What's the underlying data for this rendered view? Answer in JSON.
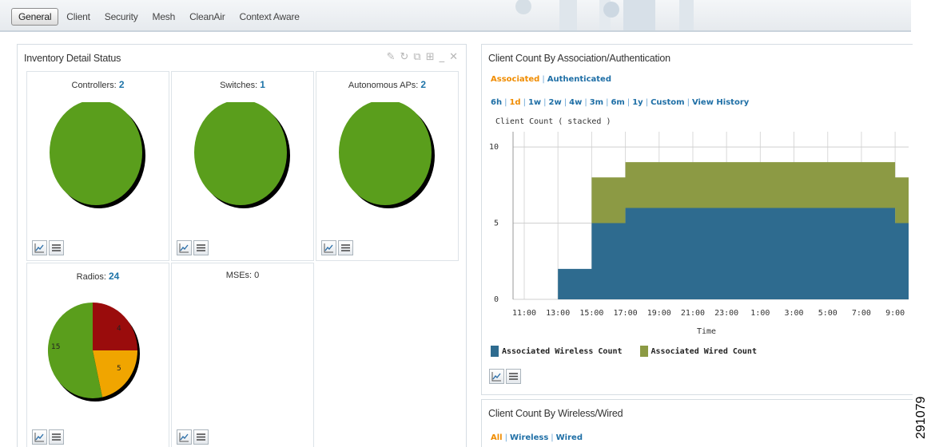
{
  "tabs": [
    {
      "label": "General",
      "active": true
    },
    {
      "label": "Client",
      "active": false
    },
    {
      "label": "Security",
      "active": false
    },
    {
      "label": "Mesh",
      "active": false
    },
    {
      "label": "CleanAir",
      "active": false
    },
    {
      "label": "Context Aware",
      "active": false
    }
  ],
  "inventory": {
    "title": "Inventory Detail Status",
    "tiles": [
      {
        "label": "Controllers:",
        "count": "2"
      },
      {
        "label": "Switches:",
        "count": "1"
      },
      {
        "label": "Autonomous APs:",
        "count": "2"
      },
      {
        "label": "Radios:",
        "count": "24"
      },
      {
        "label": "MSEs: 0",
        "count": ""
      }
    ],
    "radios_pie": {
      "green": "15",
      "red": "4",
      "orange": "5"
    },
    "colors": {
      "green": "#5a9e1c",
      "red": "#9a0c0c",
      "orange": "#f0a500"
    }
  },
  "client_count": {
    "title": "Client Count By Association/Authentication",
    "mode_links": [
      "Associated",
      "Authenticated"
    ],
    "range_links": [
      "6h",
      "1d",
      "1w",
      "2w",
      "4w",
      "3m",
      "6m",
      "1y",
      "Custom",
      "View History"
    ],
    "selected_range": "1d",
    "y_axis_title": "Client Count ( stacked )",
    "x_axis_title": "Time",
    "legend": [
      "Associated Wireless Count",
      "Associated Wired Count"
    ],
    "colors": {
      "wireless": "#2e6b8f",
      "wired": "#8c9a44"
    }
  },
  "chart_data": {
    "type": "area",
    "x": [
      "11:00",
      "13:00",
      "15:00",
      "17:00",
      "19:00",
      "21:00",
      "23:00",
      "1:00",
      "3:00",
      "5:00",
      "7:00",
      "9:00"
    ],
    "series": [
      {
        "name": "Associated Wireless Count",
        "values": [
          0,
          2,
          5,
          6,
          6,
          6,
          6,
          6,
          6,
          6,
          6,
          5
        ]
      },
      {
        "name": "Associated Wired Count",
        "values": [
          0,
          0,
          3,
          3,
          3,
          3,
          3,
          3,
          3,
          3,
          3,
          3
        ]
      }
    ],
    "yticks": [
      0,
      5,
      10
    ],
    "ylim": [
      0,
      11
    ],
    "ylabel": "Client Count ( stacked )",
    "xlabel": "Time",
    "stacked": true
  },
  "wireless_wired": {
    "title": "Client Count By Wireless/Wired",
    "links": [
      "All",
      "Wireless",
      "Wired"
    ]
  },
  "figure_code": "291079"
}
